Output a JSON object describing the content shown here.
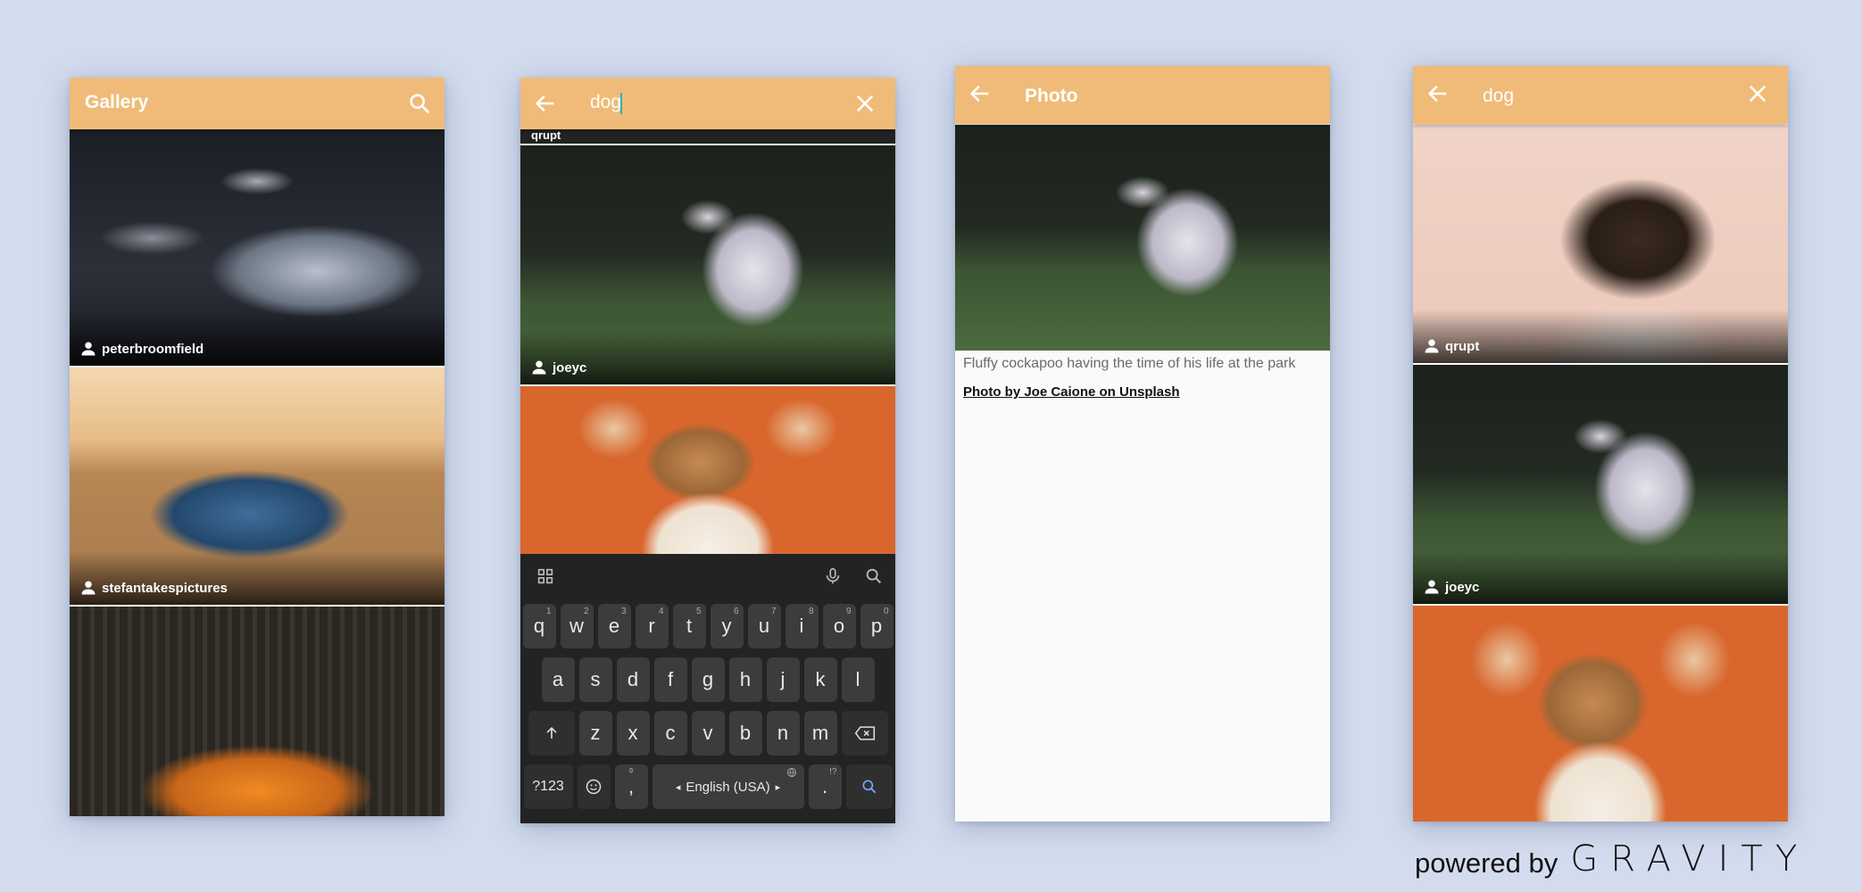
{
  "screen1": {
    "title": "Gallery",
    "icons": [
      "search-icon"
    ],
    "photos": [
      {
        "user": "peterbroomfield"
      },
      {
        "user": "stefantakespictures"
      },
      {
        "user": ""
      }
    ]
  },
  "screen2": {
    "search_value": "dog",
    "partial_user": "qrupt",
    "icons": [
      "back-arrow-icon",
      "close-icon"
    ],
    "photos": [
      {
        "user": "joeyc"
      },
      {
        "user": ""
      }
    ],
    "keyboard": {
      "row1": [
        {
          "k": "q",
          "n": "1"
        },
        {
          "k": "w",
          "n": "2"
        },
        {
          "k": "e",
          "n": "3"
        },
        {
          "k": "r",
          "n": "4"
        },
        {
          "k": "t",
          "n": "5"
        },
        {
          "k": "y",
          "n": "6"
        },
        {
          "k": "u",
          "n": "7"
        },
        {
          "k": "i",
          "n": "8"
        },
        {
          "k": "o",
          "n": "9"
        },
        {
          "k": "p",
          "n": "0"
        }
      ],
      "row2": [
        "a",
        "s",
        "d",
        "f",
        "g",
        "h",
        "j",
        "k",
        "l"
      ],
      "row3": [
        "z",
        "x",
        "c",
        "v",
        "b",
        "n",
        "m"
      ],
      "num_key": "?123",
      "comma": ",",
      "space": "English (USA)",
      "period": ".",
      "period_hint": "!?"
    }
  },
  "screen3": {
    "title": "Photo",
    "description": "Fluffy cockapoo having the time of his life at the park",
    "attribution": "Photo by Joe Caione on Unsplash"
  },
  "screen4": {
    "search_value": "dog",
    "photos": [
      {
        "user": "qrupt"
      },
      {
        "user": "joeyc"
      },
      {
        "user": ""
      }
    ]
  },
  "footer": {
    "powered_by": "powered by",
    "brand": "GRAVITY"
  },
  "colors": {
    "background": "#d3dcee",
    "appbar": "#f0bb78",
    "keyboard": "#232323"
  }
}
